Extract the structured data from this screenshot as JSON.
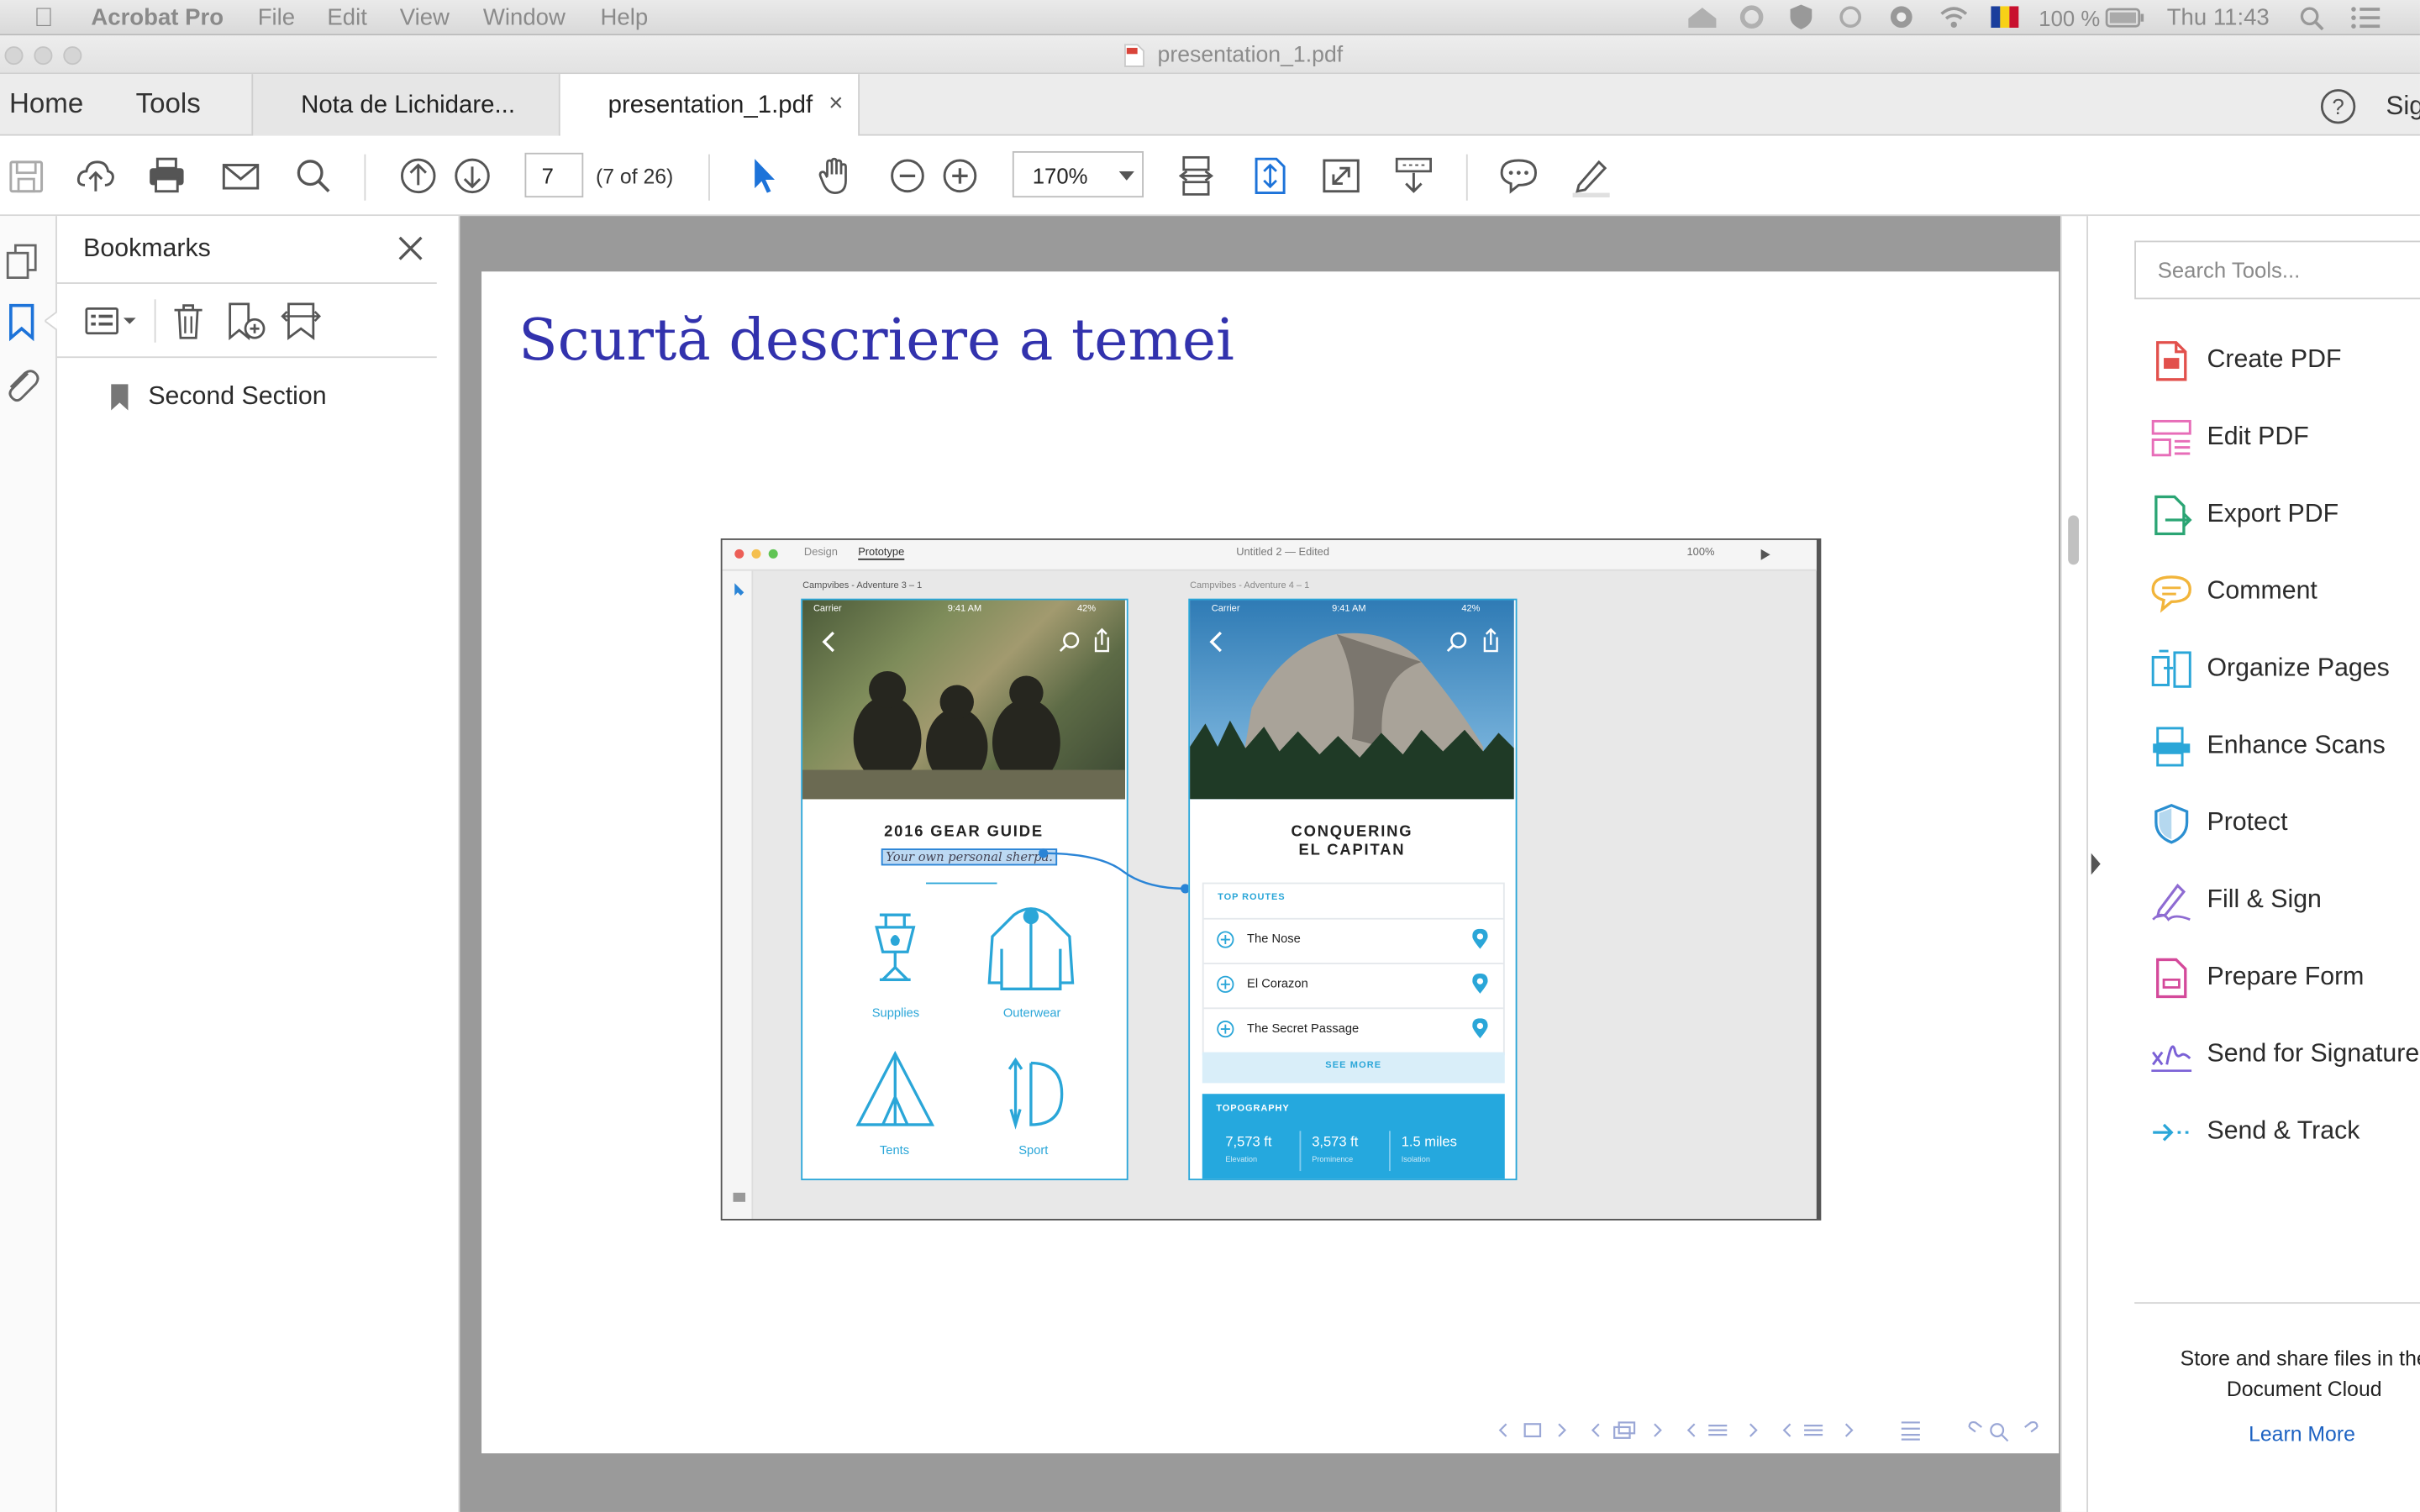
{
  "menubar": {
    "app": "Acrobat Pro",
    "items": [
      "File",
      "Edit",
      "View",
      "Window",
      "Help"
    ],
    "battery": "100 %",
    "clock": "Thu 11:43"
  },
  "window": {
    "title": "presentation_1.pdf"
  },
  "tabs": {
    "home": "Home",
    "tools": "Tools",
    "doc1": "Nota de Lichidare...",
    "doc2": "presentation_1.pdf",
    "sign": "Sig"
  },
  "toolbar": {
    "page_number": "7",
    "page_count": "(7 of 26)",
    "zoom": "170%"
  },
  "bookmarks": {
    "title": "Bookmarks",
    "items": [
      "Second Section"
    ]
  },
  "slide": {
    "title": "Scurtă descriere a temei",
    "mock": {
      "tab_design": "Design",
      "tab_prototype": "Prototype",
      "window_title": "Untitled 2 — Edited",
      "zoom": "100%",
      "artboard1": "Campvibes - Adventure 3 – 1",
      "artboard2": "Campvibes - Adventure 4 – 1",
      "status_carrier": "Carrier",
      "status_time": "9:41 AM",
      "status_batt": "42%",
      "gear_title": "2016 GEAR GUIDE",
      "gear_sub": "Your own personal sherpa.",
      "cat1": "Supplies",
      "cat2": "Outerwear",
      "cat3": "Tents",
      "cat4": "Sport",
      "cap_title1": "CONQUERING",
      "cap_title2": "EL CAPITAN",
      "routes_header": "TOP ROUTES",
      "route1": "The Nose",
      "route2": "El Corazon",
      "route3": "The Secret Passage",
      "see_more": "SEE MORE",
      "topo_header": "TOPOGRAPHY",
      "stat1": "7,573 ft",
      "stat1_label": "Elevation",
      "stat2": "3,573 ft",
      "stat2_label": "Prominence",
      "stat3": "1.5 miles",
      "stat3_label": "Isolation"
    }
  },
  "tools_pane": {
    "search_placeholder": "Search Tools...",
    "items": [
      {
        "label": "Create PDF",
        "color": "#e2504c"
      },
      {
        "label": "Edit PDF",
        "color": "#e76db8"
      },
      {
        "label": "Export PDF",
        "color": "#2ba574"
      },
      {
        "label": "Comment",
        "color": "#f2b53b"
      },
      {
        "label": "Organize Pages",
        "color": "#2aa6d8"
      },
      {
        "label": "Enhance Scans",
        "color": "#2aa6d8"
      },
      {
        "label": "Protect",
        "color": "#2b8fd1"
      },
      {
        "label": "Fill & Sign",
        "color": "#8e6bd2"
      },
      {
        "label": "Prepare Form",
        "color": "#d4499a"
      },
      {
        "label": "Send for Signature",
        "color": "#7b61d6"
      },
      {
        "label": "Send & Track",
        "color": "#2aa6d8"
      }
    ],
    "cloud_text1": "Store and share files in the",
    "cloud_text2": "Document Cloud",
    "learn_more": "Learn More"
  }
}
